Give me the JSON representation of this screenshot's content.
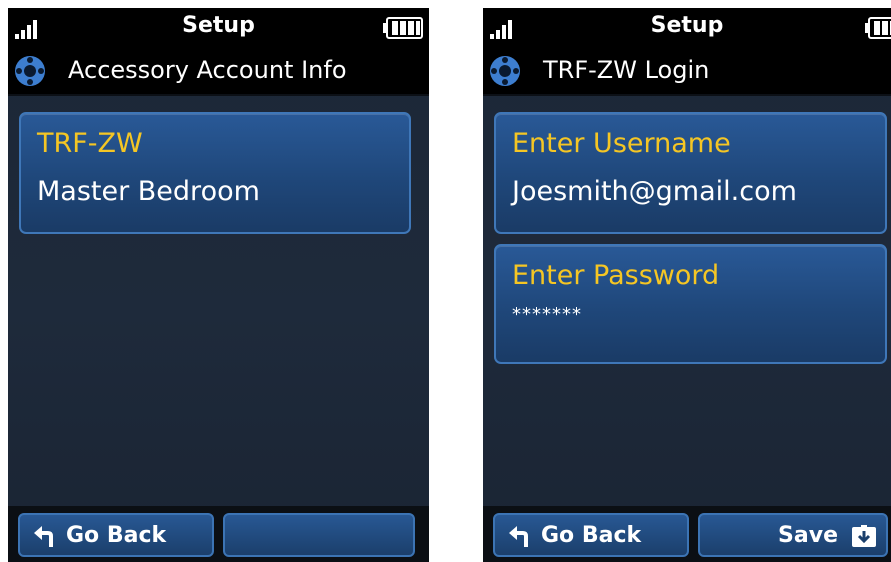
{
  "left_screen": {
    "status_title": "Setup",
    "header_title": "Accessory Account Info",
    "card": {
      "title": "TRF-ZW",
      "value": "Master Bedroom"
    },
    "back_label": "Go Back",
    "right_softkey_label": ""
  },
  "right_screen": {
    "status_title": "Setup",
    "header_title": "TRF-ZW Login",
    "username": {
      "label": "Enter Username",
      "value": "Joesmith@gmail.com"
    },
    "password": {
      "label": "Enter Password",
      "value": "*******"
    },
    "back_label": "Go Back",
    "save_label": "Save"
  },
  "icons": {
    "signal": "signal-strength-icon",
    "battery": "battery-icon",
    "app": "accessory-icon",
    "back": "back-arrow-icon",
    "save": "save-icon"
  },
  "colors": {
    "accent_yellow": "#f5c624",
    "button_blue": "#285894",
    "background": "#1e2a3b"
  }
}
